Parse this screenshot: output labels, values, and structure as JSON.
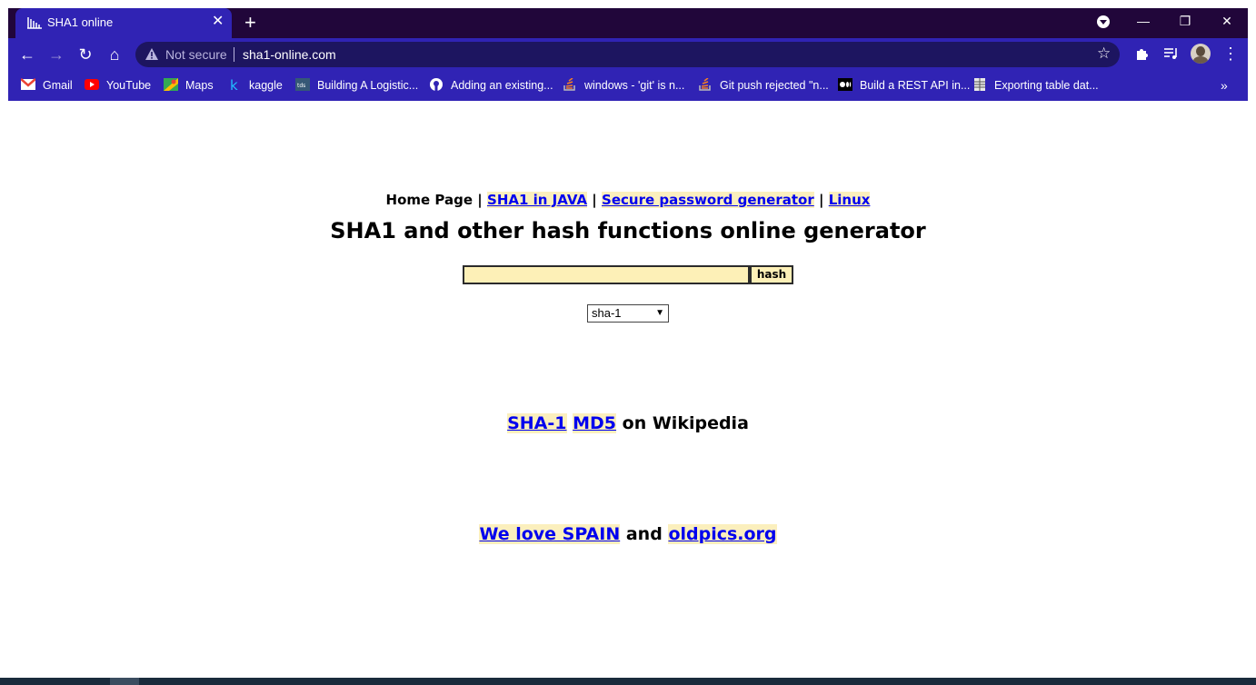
{
  "browser": {
    "tab": {
      "title": "SHA1 online",
      "close": "✕"
    },
    "new_tab": "+",
    "window_controls": {
      "minimize": "—",
      "restore": "❐",
      "close": "✕"
    },
    "nav": {
      "back": "←",
      "forward": "→",
      "reload": "↻",
      "home": "⌂"
    },
    "omnibox": {
      "security": "Not secure",
      "url": "sha1-online.com",
      "bookmark_star": "☆"
    },
    "menu": "⋮",
    "bookmarks": [
      {
        "label": "Gmail",
        "icon": "gmail-icon"
      },
      {
        "label": "YouTube",
        "icon": "youtube-icon"
      },
      {
        "label": "Maps",
        "icon": "maps-icon"
      },
      {
        "label": "kaggle",
        "icon": "kaggle-icon"
      },
      {
        "label": "Building A Logistic...",
        "icon": "tds-icon"
      },
      {
        "label": "Adding an existing...",
        "icon": "github-icon"
      },
      {
        "label": "windows - 'git' is n...",
        "icon": "stackoverflow-icon"
      },
      {
        "label": "Git push rejected \"n...",
        "icon": "stackoverflow-icon"
      },
      {
        "label": "Build a REST API in...",
        "icon": "medium-icon"
      },
      {
        "label": "Exporting table dat...",
        "icon": "sheet-icon"
      }
    ],
    "bookmarks_more": "»"
  },
  "page": {
    "nav": {
      "home": "Home Page",
      "sep": "|",
      "java": "SHA1 in JAVA",
      "password": "Secure password generator",
      "linux": "Linux"
    },
    "title": "SHA1 and other hash functions online generator",
    "hash_input": {
      "value": ""
    },
    "hash_button": "hash",
    "algorithm": {
      "selected": "sha-1"
    },
    "wiki": {
      "sha1": "SHA-1",
      "md5": "MD5",
      "suffix": "on Wikipedia"
    },
    "footer": {
      "spain": "We love SPAIN",
      "and": "and",
      "oldpics": "oldpics.org"
    }
  }
}
